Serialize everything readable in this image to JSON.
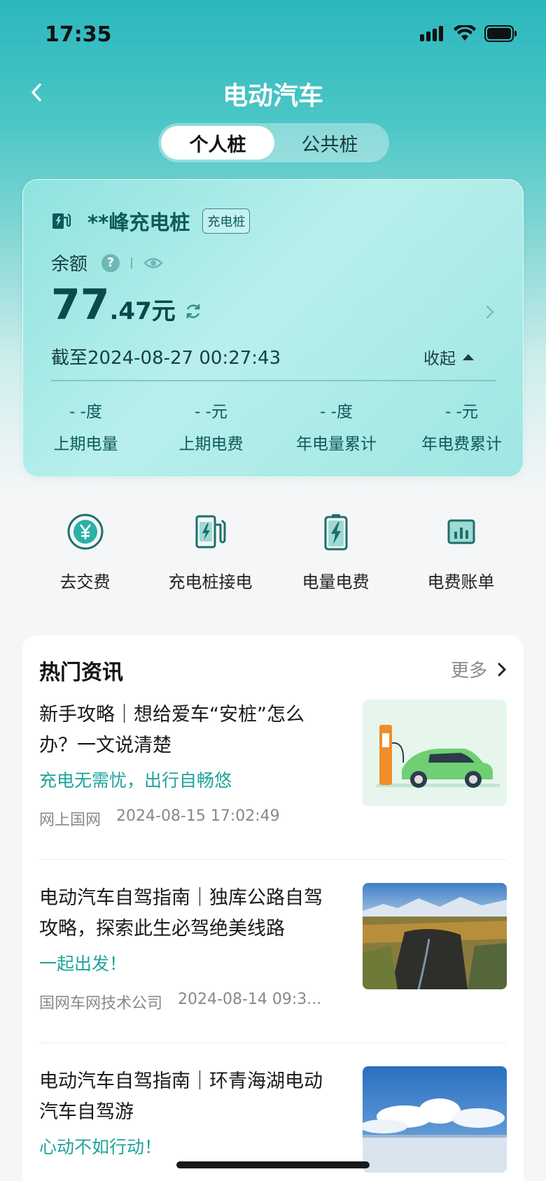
{
  "status_bar": {
    "time": "17:35"
  },
  "nav": {
    "title": "电动汽车"
  },
  "segment": {
    "tabs": [
      "个人桩",
      "公共桩"
    ],
    "active_index": 0
  },
  "balance_card": {
    "pile_name": "**峰充电桩",
    "pile_badge": "充电桩",
    "balance_label": "余额",
    "amount_int": "77",
    "amount_dec": ".47",
    "amount_unit": "元",
    "as_of": "截至2024-08-27 00:27:43",
    "collapse_label": "收起",
    "stats": [
      {
        "value": "- -度",
        "label": "上期电量"
      },
      {
        "value": "- -元",
        "label": "上期电费"
      },
      {
        "value": "- -度",
        "label": "年电量累计"
      },
      {
        "value": "- -元",
        "label": "年电费累计"
      }
    ]
  },
  "quick_actions": [
    {
      "label": "去交费",
      "icon": "yuan-coin-icon"
    },
    {
      "label": "充电桩接电",
      "icon": "charging-pile-icon"
    },
    {
      "label": "电量电费",
      "icon": "battery-bolt-icon"
    },
    {
      "label": "电费账单",
      "icon": "bar-chart-icon"
    }
  ],
  "news": {
    "title": "热门资讯",
    "more_label": "更多",
    "items": [
      {
        "headline": "新手攻略｜想给爱车“安桩”怎么办？一文说清楚",
        "subtitle": "充电无需忧，出行自畅悠",
        "source": "网上国网",
        "time": "2024-08-15 17:02:49"
      },
      {
        "headline": "电动汽车自驾指南｜独库公路自驾攻略，探索此生必驾绝美线路",
        "subtitle": "一起出发！",
        "source": "国网车网技术公司",
        "time": "2024-08-14 09:3..."
      },
      {
        "headline": "电动汽车自驾指南｜环青海湖电动汽车自驾游",
        "subtitle": "心动不如行动！",
        "source": "",
        "time": ""
      }
    ]
  },
  "colors": {
    "brand_teal": "#1fa39b",
    "dark_teal": "#0b4a4a"
  }
}
